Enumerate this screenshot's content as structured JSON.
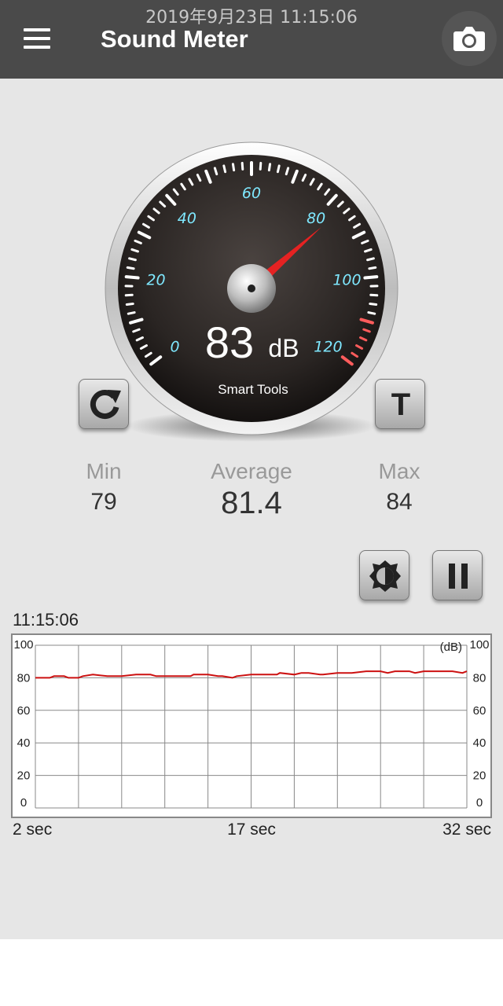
{
  "status_bar": {
    "datetime": "2019年9月23日 11:15:06"
  },
  "app_bar": {
    "title": "Sound Meter",
    "menu_icon": "hamburger-menu-icon",
    "camera_icon": "camera-icon"
  },
  "gauge": {
    "reading": "83",
    "unit": "dB",
    "reading_value": 83,
    "brand": "Smart Tools",
    "scale_labels": [
      "0",
      "20",
      "40",
      "60",
      "80",
      "100",
      "120"
    ],
    "scale_min": 0,
    "scale_max": 120,
    "danger_zone_start": 110,
    "colors": {
      "needle": "#e52222",
      "labels": "#7fe8ff",
      "danger": "#ff5c5c"
    }
  },
  "buttons": {
    "reset_icon": "refresh-icon",
    "threshold_label": "T",
    "brightness_icon": "brightness-icon",
    "pause_icon": "pause-icon"
  },
  "stats": {
    "min_label": "Min",
    "min_value": "79",
    "avg_label": "Average",
    "avg_value": "81.4",
    "max_label": "Max",
    "max_value": "84"
  },
  "chart_data": {
    "type": "line",
    "time_label": "11:15:06",
    "unit_label": "(dB)",
    "y_ticks": [
      "100",
      "80",
      "60",
      "40",
      "20",
      "0"
    ],
    "ylim": [
      0,
      100
    ],
    "x_tick_labels": [
      "2 sec",
      "17 sec",
      "32 sec"
    ],
    "xlim": [
      2,
      32
    ],
    "grid": true,
    "line_color": "#cc1111",
    "series": [
      {
        "x": [
          2,
          3,
          3.3,
          4,
          4.3,
          5,
          5.3,
          6,
          7,
          7.6,
          8,
          9,
          10,
          10.4,
          10.6,
          11,
          12,
          12.8,
          13,
          14,
          14.7,
          15,
          15.7,
          16,
          17,
          18,
          18.8,
          19,
          20,
          20.5,
          21,
          21.8,
          22,
          23,
          24,
          25,
          26,
          26.5,
          27,
          28,
          28.4,
          29,
          30,
          31,
          31.7,
          32
        ],
        "y": [
          80,
          80,
          81,
          81,
          80,
          80,
          81,
          82,
          81,
          81,
          81,
          82,
          82,
          81,
          81,
          81,
          81,
          81,
          82,
          82,
          81,
          81,
          80,
          81,
          82,
          82,
          82,
          83,
          82,
          83,
          83,
          82,
          82,
          83,
          83,
          84,
          84,
          83,
          84,
          84,
          83,
          84,
          84,
          84,
          83,
          84
        ]
      }
    ]
  }
}
